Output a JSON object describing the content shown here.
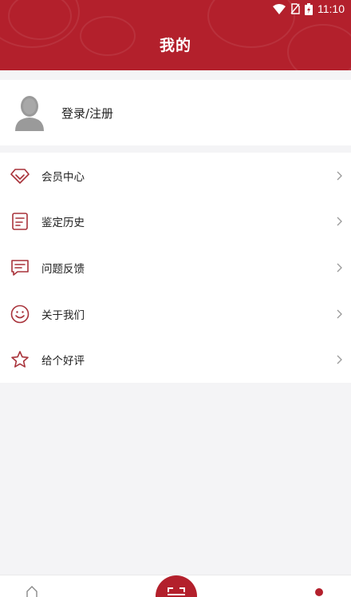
{
  "status_bar": {
    "time": "11:10"
  },
  "header": {
    "title": "我的"
  },
  "profile": {
    "login_label": "登录/注册"
  },
  "menu": {
    "items": [
      {
        "label": "会员中心",
        "icon": "diamond-icon"
      },
      {
        "label": "鉴定历史",
        "icon": "document-icon"
      },
      {
        "label": "问题反馈",
        "icon": "chat-icon"
      },
      {
        "label": "关于我们",
        "icon": "smiley-icon"
      },
      {
        "label": "给个好评",
        "icon": "star-icon"
      }
    ]
  },
  "bottom_nav": {
    "tabs": [
      {
        "icon": "home-icon"
      },
      {
        "icon": "scan-icon"
      },
      {
        "icon": "mine-icon"
      }
    ]
  },
  "colors": {
    "brand": "#b3202c",
    "icon": "#a8323a",
    "background": "#f4f4f6"
  }
}
